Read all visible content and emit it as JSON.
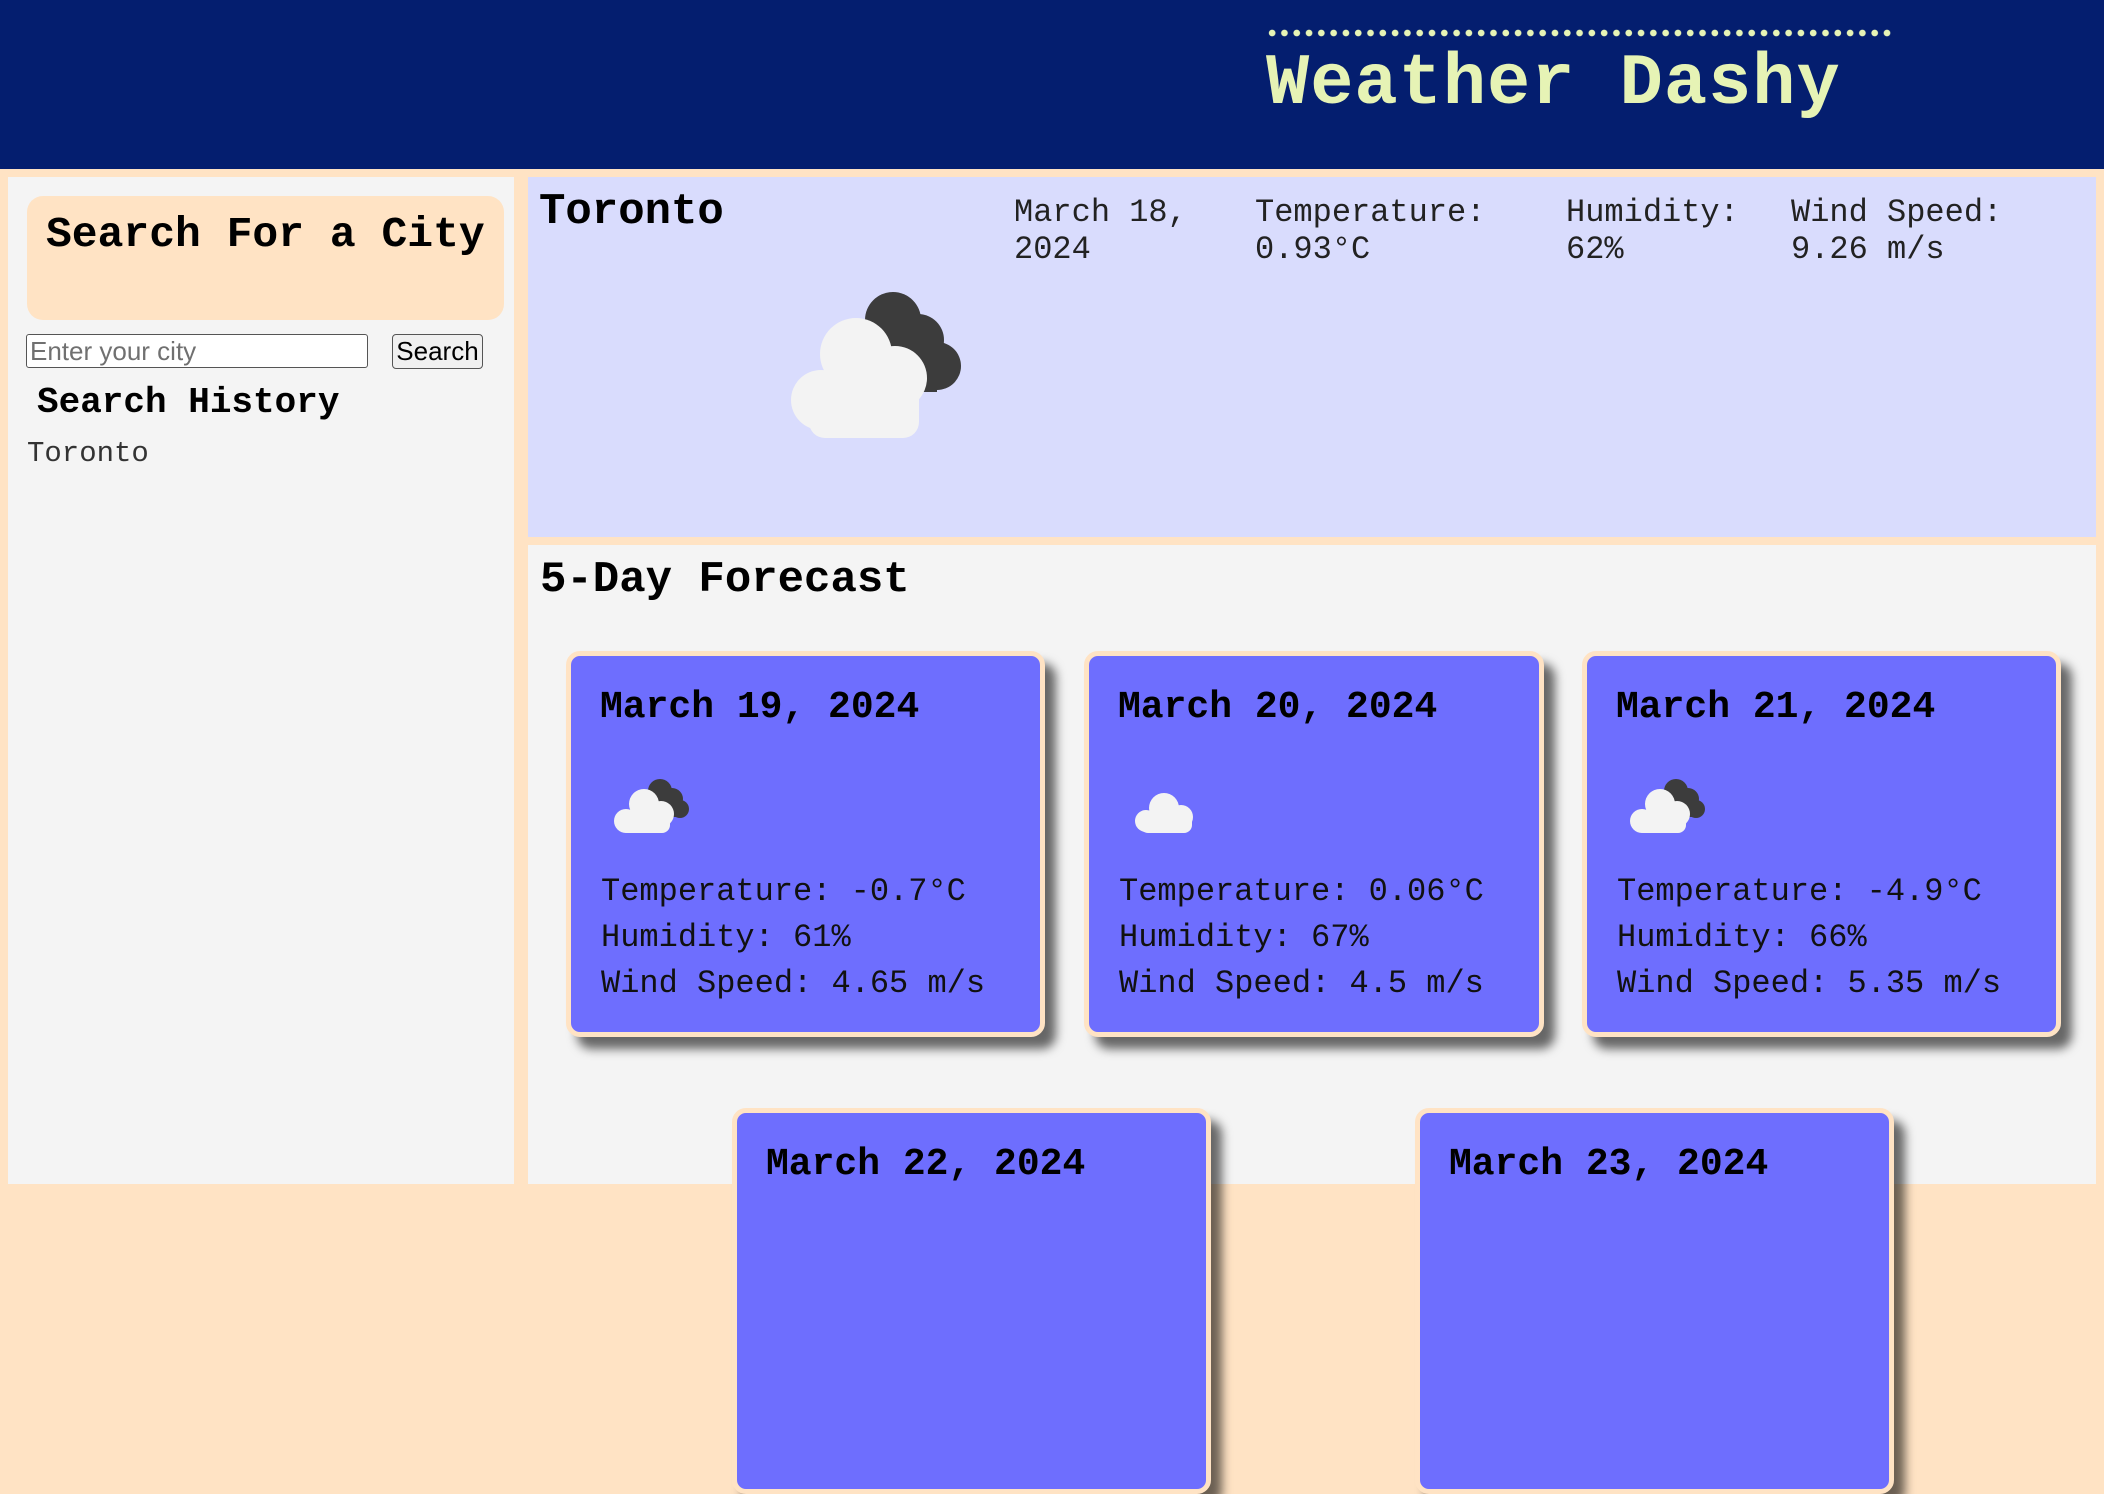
{
  "header": {
    "title": "Weather Dashy"
  },
  "sidebar": {
    "heading": "Search For a City",
    "input": {
      "placeholder": "Enter your city",
      "value": ""
    },
    "search_button": "Search",
    "history_heading": "Search History",
    "history": [
      "Toronto"
    ]
  },
  "current": {
    "city": "Toronto",
    "date": "March 18, 2024",
    "temperature": "Temperature: 0.93°C",
    "humidity": "Humidity: 62%",
    "wind": "Wind Speed: 9.26 m/s",
    "icon": "cloud-night-icon"
  },
  "forecast": {
    "title": "5-Day Forecast",
    "days": [
      {
        "date": "March 19, 2024",
        "icon": "cloud-night-icon",
        "temperature": "Temperature: -0.7°C",
        "humidity": "Humidity: 61%",
        "wind": "Wind Speed: 4.65 m/s"
      },
      {
        "date": "March 20, 2024",
        "icon": "cloud-icon",
        "temperature": "Temperature: 0.06°C",
        "humidity": "Humidity: 67%",
        "wind": "Wind Speed: 4.5 m/s"
      },
      {
        "date": "March 21, 2024",
        "icon": "cloud-night-icon",
        "temperature": "Temperature: -4.9°C",
        "humidity": "Humidity: 66%",
        "wind": "Wind Speed: 5.35 m/s"
      },
      {
        "date": "March 22, 2024",
        "icon": "cloud-icon"
      },
      {
        "date": "March 23, 2024",
        "icon": "cloud-icon"
      }
    ]
  },
  "colors": {
    "header_bg": "#041e6f",
    "title": "#e6f3b5",
    "accent": "#ffe3c4",
    "current_bg": "#d9dcfd",
    "card_bg": "#6e6efe"
  }
}
